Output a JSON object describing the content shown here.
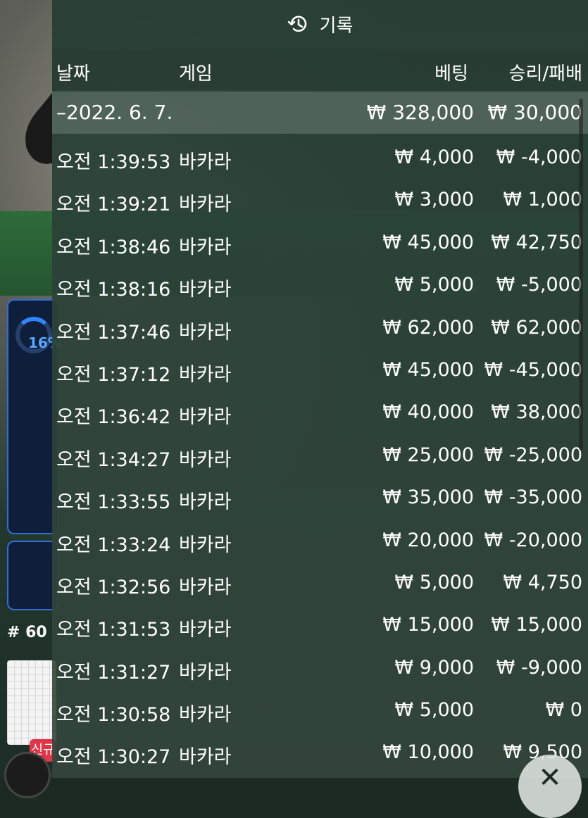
{
  "background": {
    "progress_percent_label": "16%",
    "round_number": "# 60",
    "new_badge": "신규"
  },
  "history": {
    "title": "기록",
    "title_icon": "history-icon",
    "columns": {
      "date": "날짜",
      "game": "게임",
      "bet": "베팅",
      "win_loss": "승리/패배"
    },
    "date_group": {
      "label": "–2022. 6. 7.",
      "total_bet": "₩ 328,000",
      "total_win_loss": "₩ 30,000"
    },
    "rows": [
      {
        "time": "오전 1:39:53",
        "game": "바카라",
        "bet": "₩ 4,000",
        "result": "₩ -4,000"
      },
      {
        "time": "오전 1:39:21",
        "game": "바카라",
        "bet": "₩ 3,000",
        "result": "₩ 1,000"
      },
      {
        "time": "오전 1:38:46",
        "game": "바카라",
        "bet": "₩ 45,000",
        "result": "₩ 42,750"
      },
      {
        "time": "오전 1:38:16",
        "game": "바카라",
        "bet": "₩ 5,000",
        "result": "₩ -5,000"
      },
      {
        "time": "오전 1:37:46",
        "game": "바카라",
        "bet": "₩ 62,000",
        "result": "₩ 62,000"
      },
      {
        "time": "오전 1:37:12",
        "game": "바카라",
        "bet": "₩ 45,000",
        "result": "₩ -45,000"
      },
      {
        "time": "오전 1:36:42",
        "game": "바카라",
        "bet": "₩ 40,000",
        "result": "₩ 38,000"
      },
      {
        "time": "오전 1:34:27",
        "game": "바카라",
        "bet": "₩ 25,000",
        "result": "₩ -25,000"
      },
      {
        "time": "오전 1:33:55",
        "game": "바카라",
        "bet": "₩ 35,000",
        "result": "₩ -35,000"
      },
      {
        "time": "오전 1:33:24",
        "game": "바카라",
        "bet": "₩ 20,000",
        "result": "₩ -20,000"
      },
      {
        "time": "오전 1:32:56",
        "game": "바카라",
        "bet": "₩ 5,000",
        "result": "₩ 4,750"
      },
      {
        "time": "오전 1:31:53",
        "game": "바카라",
        "bet": "₩ 15,000",
        "result": "₩ 15,000"
      },
      {
        "time": "오전 1:31:27",
        "game": "바카라",
        "bet": "₩ 9,000",
        "result": "₩ -9,000"
      },
      {
        "time": "오전 1:30:58",
        "game": "바카라",
        "bet": "₩ 5,000",
        "result": "₩ 0"
      },
      {
        "time": "오전 1:30:27",
        "game": "바카라",
        "bet": "₩ 10,000",
        "result": "₩ 9,500"
      }
    ],
    "close_icon": "close-icon"
  }
}
